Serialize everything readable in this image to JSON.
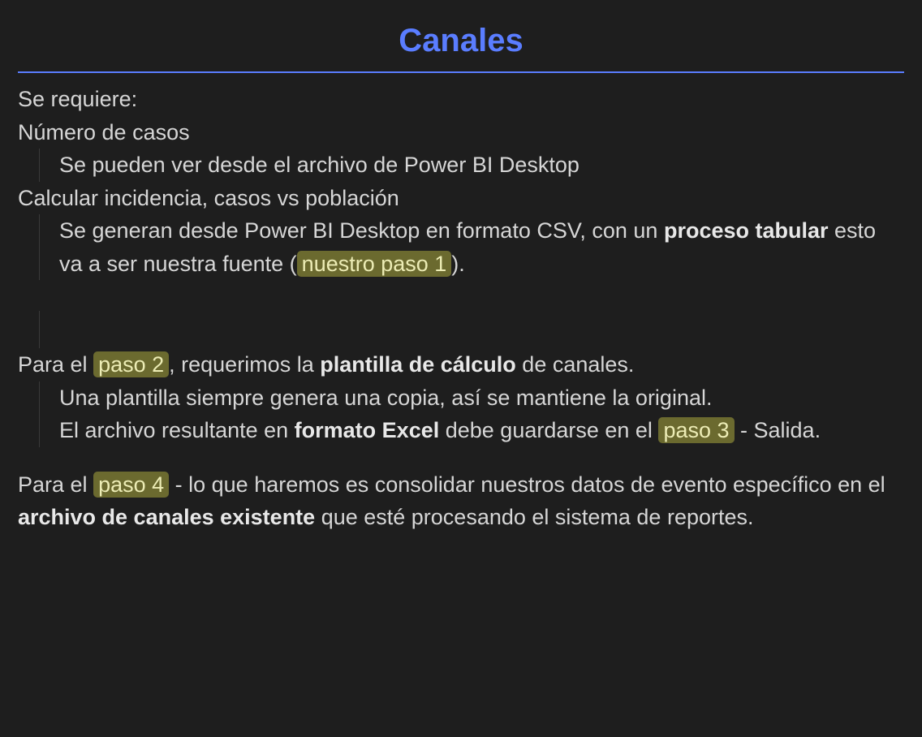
{
  "title": "Canales",
  "line_se_requiere": "Se requiere:",
  "line_numero_casos": "Número de casos",
  "line_desde_powerbi": "Se pueden ver desde el archivo de Power BI Desktop",
  "line_calc_incidencia": "Calcular incidencia, casos vs población",
  "csv_line": {
    "p1": "Se generan desde Power BI Desktop en formato CSV, con un ",
    "bold1": "proceso tabular",
    "p2": " esto va a ser nuestra fuente (",
    "hl": "nuestro paso 1",
    "p3": ")."
  },
  "paso2_line": {
    "p1": "Para el ",
    "hl": "paso 2",
    "p2": ", requerimos la ",
    "bold1": "plantilla de cálculo",
    "p3": " de canales."
  },
  "plantilla_copia": "Una plantilla siempre genera una copia, así se mantiene la original.",
  "excel_line": {
    "p1": "El archivo resultante en ",
    "bold1": "formato Excel",
    "p2": " debe guardarse en el ",
    "hl": "paso 3",
    "p3": " - Salida."
  },
  "paso4_line": {
    "p1": "Para el ",
    "hl": "paso 4",
    "p2": " - lo que haremos es consolidar nuestros datos de evento específico en el ",
    "bold1": "archivo de canales existente",
    "p3": " que esté procesando el sistema de reportes."
  }
}
